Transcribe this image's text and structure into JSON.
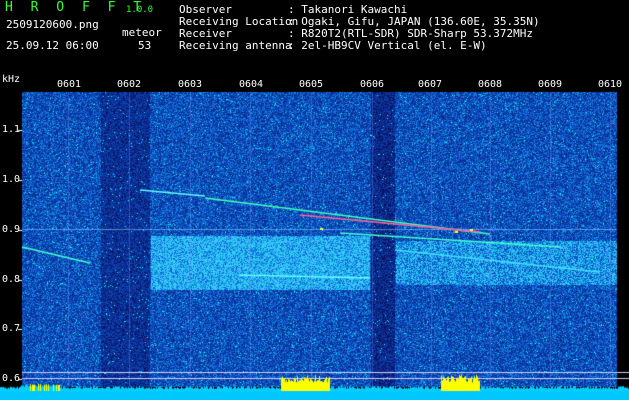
{
  "header": {
    "logo": "H R O F F T",
    "version": "1.0.0",
    "file_name": "2509120600.png",
    "datetime": "25.09.12 06:00",
    "meteor_label": "meteor",
    "meteor_count": "53"
  },
  "info": [
    {
      "label": "Observer",
      "value": ": Takanori Kawachi"
    },
    {
      "label": "Receiving Location",
      "value": ": Ogaki, Gifu, JAPAN (136.60E, 35.35N)"
    },
    {
      "label": "Receiver",
      "value": ": R820T2(RTL-SDR) SDR-Sharp 53.372MHz"
    },
    {
      "label": "Receiving antenna",
      "value": ": 2el-HB9CV Vertical (el. E-W)"
    }
  ],
  "axes": {
    "y_unit": "kHz",
    "y_ticks": [
      "1.1",
      "1.0",
      "0.9",
      "0.8",
      "0.7",
      "0.6"
    ],
    "x_ticks": [
      "0601",
      "0602",
      "0603",
      "0604",
      "0605",
      "0606",
      "0607",
      "0608",
      "0609",
      "0610"
    ]
  },
  "colors": {
    "background": "#000000",
    "spectrogram_base": "#0a1a8a",
    "signal": "#00ffff",
    "peak": "#ffff00",
    "axis": "#ffffff",
    "brand": "#33ff33"
  }
}
